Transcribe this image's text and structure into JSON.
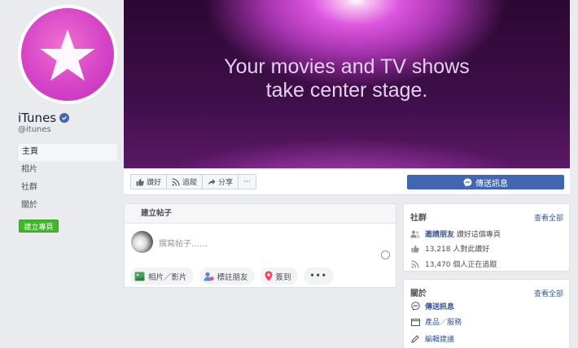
{
  "page": {
    "name": "iTunes",
    "handle": "@itunes",
    "avatar_icon": "star-icon",
    "brand_color": "#d644c8"
  },
  "sidebar": {
    "items": [
      {
        "label": "主頁",
        "active": true
      },
      {
        "label": "相片",
        "active": false
      },
      {
        "label": "社群",
        "active": false
      },
      {
        "label": "關於",
        "active": false
      }
    ],
    "create_page_label": "建立專頁"
  },
  "cover": {
    "line1": "Your movies and TV shows",
    "line2": "take center stage."
  },
  "actions": {
    "like": "讚好",
    "follow": "追蹤",
    "share": "分享",
    "more": "···",
    "send_message": "傳送訊息"
  },
  "create_post": {
    "title": "建立帖子",
    "placeholder": "撰寫帖子……",
    "photo_video": "相片／影片",
    "tag_friends": "標註朋友",
    "check_in": "簽到",
    "more": "•••"
  },
  "community": {
    "title": "社群",
    "see_all": "查看全部",
    "invite_link": "邀請朋友",
    "invite_text": "讚好這個專頁",
    "likes_text": "13,218 人對此讚好",
    "follows_text": "13,470 個人正在追蹤"
  },
  "about": {
    "title": "關於",
    "see_all": "查看全部",
    "send_message": "傳送訊息",
    "products": "產品／服務",
    "suggest_edits": "編輯建議"
  }
}
